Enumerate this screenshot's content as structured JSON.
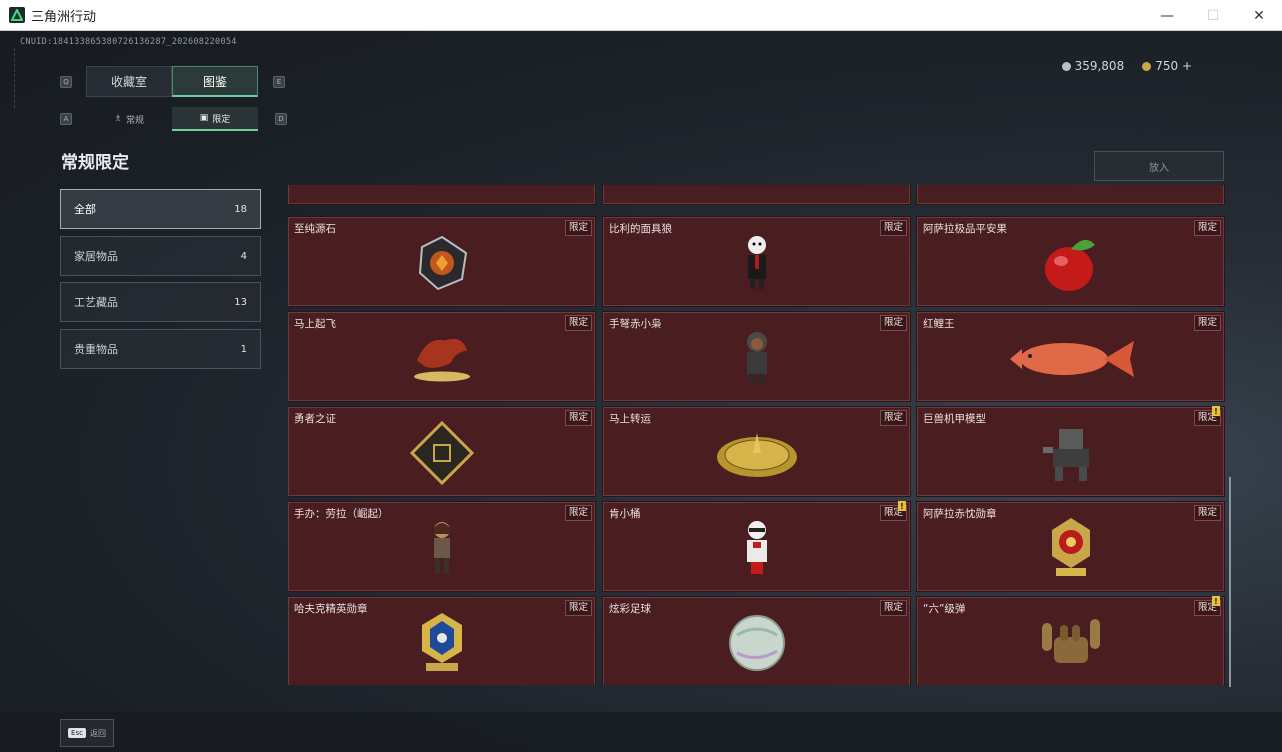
{
  "window": {
    "title": "三角洲行动",
    "minimize": "—",
    "maximize": "☐",
    "close": "✕"
  },
  "uid": "CNUID:184133865380726136287_202608220054",
  "currency": [
    {
      "icon": "silver-coin-icon",
      "value": "359,808"
    },
    {
      "icon": "gold-coin-icon",
      "value": "750"
    }
  ],
  "currency_add": "+",
  "key_hints": {
    "q": "Q",
    "e": "E",
    "a": "A",
    "d": "D"
  },
  "tabs": [
    {
      "label": "收藏室"
    },
    {
      "label": "图鉴"
    }
  ],
  "subtabs": [
    {
      "label": "常规"
    },
    {
      "label": "限定"
    }
  ],
  "page_title": "常规限定",
  "put_in_button": "放入",
  "categories": [
    {
      "label": "全部",
      "count": "18"
    },
    {
      "label": "家居物品",
      "count": "4"
    },
    {
      "label": "工艺藏品",
      "count": "13"
    },
    {
      "label": "贵重物品",
      "count": "1"
    }
  ],
  "tag_label": "限定",
  "items": [
    {
      "name": "至纯源石",
      "icon": "gem-stone-icon",
      "warn": false
    },
    {
      "name": "比利的面具狼",
      "icon": "puppet-figure-icon",
      "warn": false
    },
    {
      "name": "阿萨拉极品平安果",
      "icon": "apple-icon",
      "warn": false
    },
    {
      "name": "马上起飞",
      "icon": "horse-statue-icon",
      "warn": false
    },
    {
      "name": "手弩赤小枭",
      "icon": "hooded-figure-icon",
      "warn": false
    },
    {
      "name": "红鲤王",
      "icon": "carp-fish-icon",
      "warn": false
    },
    {
      "name": "勇者之证",
      "icon": "card-badge-icon",
      "warn": false
    },
    {
      "name": "马上转运",
      "icon": "compass-disc-icon",
      "warn": false
    },
    {
      "name": "巨兽机甲模型",
      "icon": "mech-model-icon",
      "warn": true
    },
    {
      "name": "手办：劳拉（崛起）",
      "icon": "figure-doll-icon",
      "warn": false
    },
    {
      "name": "肯小桶",
      "icon": "chef-figure-icon",
      "warn": true
    },
    {
      "name": "阿萨拉赤忱勋章",
      "icon": "red-medal-icon",
      "warn": false
    },
    {
      "name": "哈夫克精英勋章",
      "icon": "blue-medal-icon",
      "warn": false
    },
    {
      "name": "炫彩足球",
      "icon": "soccer-ball-icon",
      "warn": false
    },
    {
      "name": "“六”级弹",
      "icon": "hand-sign-icon",
      "warn": true
    }
  ],
  "back": {
    "key": "Esc",
    "label": "返回"
  }
}
